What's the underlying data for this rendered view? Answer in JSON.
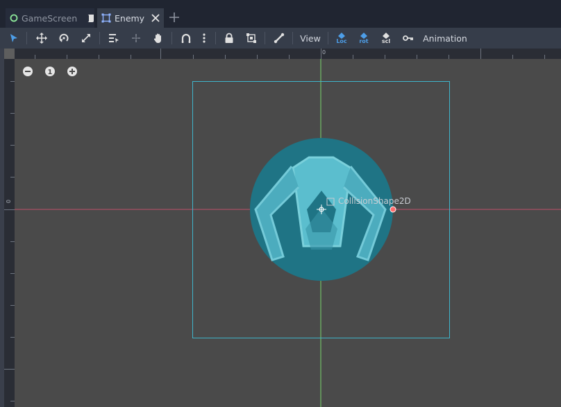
{
  "tabs": [
    {
      "label": "GameScreen",
      "icon": "node-circle-icon",
      "active": false
    },
    {
      "label": "Enemy",
      "icon": "scene-node2d-icon",
      "active": true
    }
  ],
  "toolbar": {
    "view_label": "View",
    "animation_label": "Animation",
    "loc_label": "Loc",
    "rot_label": "rot",
    "scl_label": "scl"
  },
  "viewport": {
    "ruler_zero_h": "0",
    "ruler_zero_v": "0",
    "node_label": "CollisionShape2D",
    "zoom_reset_label": "1"
  },
  "colors": {
    "accent": "#4d9ee8",
    "x_axis": "#c0506a",
    "y_axis": "#7ad46a",
    "selection": "#3fb6cc",
    "body": "#1f7485",
    "handle": "#ff6b6b"
  }
}
